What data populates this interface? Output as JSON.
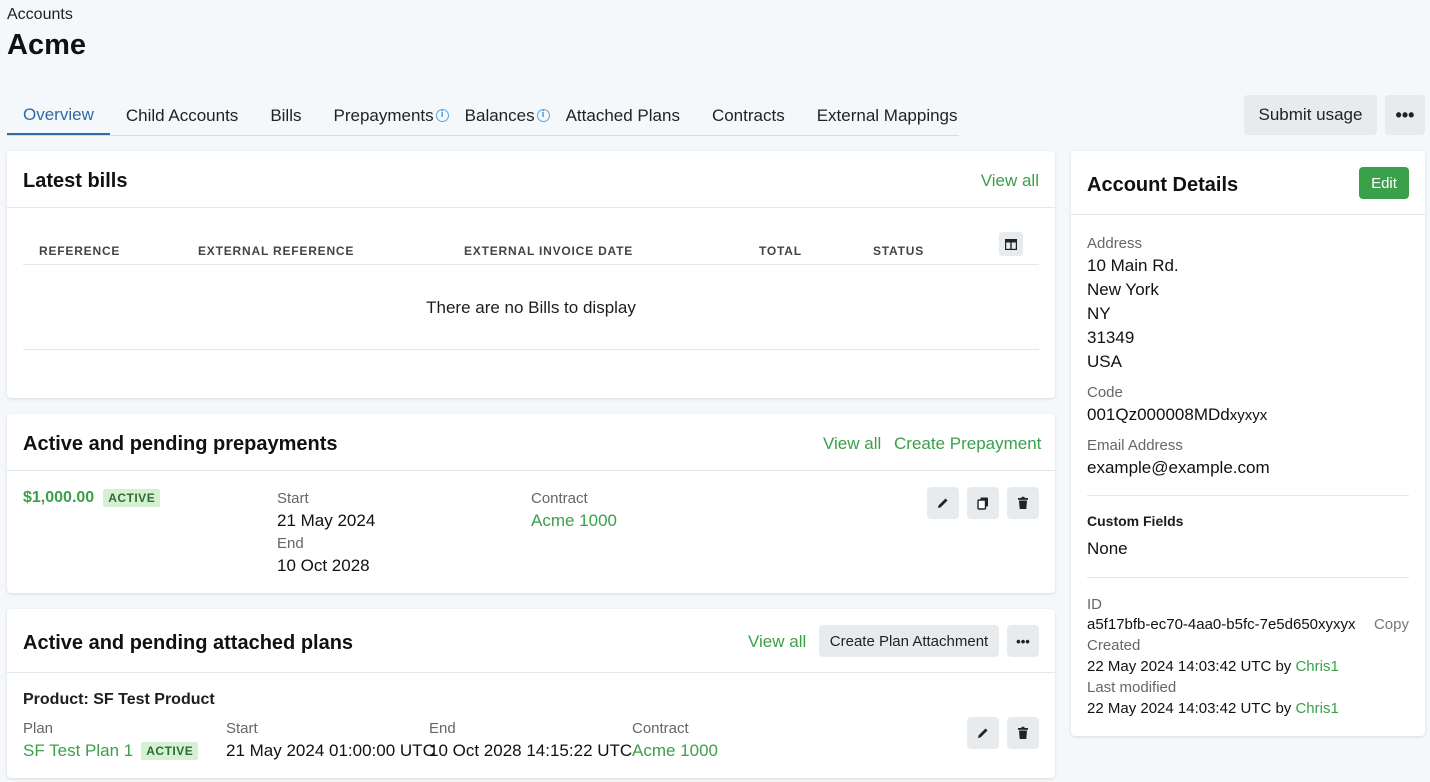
{
  "breadcrumb": "Accounts",
  "page_title": "Acme",
  "tabs": [
    {
      "label": "Overview"
    },
    {
      "label": "Child Accounts"
    },
    {
      "label": "Bills"
    },
    {
      "label": "Prepayments"
    },
    {
      "label": "Balances"
    },
    {
      "label": "Attached Plans"
    },
    {
      "label": "Contracts"
    },
    {
      "label": "External Mappings"
    }
  ],
  "actions": {
    "submit_usage": "Submit usage",
    "more": "•••"
  },
  "bills": {
    "title": "Latest bills",
    "view_all": "View all",
    "columns": [
      "REFERENCE",
      "EXTERNAL REFERENCE",
      "EXTERNAL INVOICE DATE",
      "TOTAL",
      "STATUS"
    ],
    "empty": "There are no Bills to display"
  },
  "prepayments": {
    "title": "Active and pending prepayments",
    "view_all": "View all",
    "create": "Create Prepayment",
    "item": {
      "amount": "$1,000.00",
      "status": "ACTIVE",
      "start_label": "Start",
      "start": "21 May 2024",
      "end_label": "End",
      "end": "10 Oct 2028",
      "contract_label": "Contract",
      "contract": "Acme 1000"
    }
  },
  "plans": {
    "title": "Active and pending attached plans",
    "view_all": "View all",
    "create": "Create Plan Attachment",
    "more": "•••",
    "item": {
      "product": "Product: SF Test Product",
      "plan_label": "Plan",
      "plan": "SF Test Plan 1",
      "status": "ACTIVE",
      "start_label": "Start",
      "start": "21 May 2024 01:00:00 UTC",
      "end_label": "End",
      "end": "10 Oct 2028 14:15:22 UTC",
      "contract_label": "Contract",
      "contract": "Acme 1000"
    }
  },
  "details": {
    "title": "Account Details",
    "edit": "Edit",
    "address_label": "Address",
    "address_lines": [
      "10 Main Rd.",
      "New York",
      "NY",
      "31349",
      "USA"
    ],
    "code_label": "Code",
    "code": "001Qz000008MDd",
    "code_suffix": "xyxyx",
    "email_label": "Email Address",
    "email": "example@example.com",
    "custom_fields_label": "Custom Fields",
    "custom_fields": "None",
    "id_label": "ID",
    "id": "a5f17bfb-ec70-4aa0-b5fc-7e5d650",
    "id_suffix": "xyxyx",
    "copy": "Copy",
    "created_label": "Created",
    "created": "22 May 2024 14:03:42 UTC by",
    "created_by": "Chris1",
    "modified_label": "Last modified",
    "modified": "22 May 2024 14:03:42 UTC by",
    "modified_by": "Chris1"
  }
}
